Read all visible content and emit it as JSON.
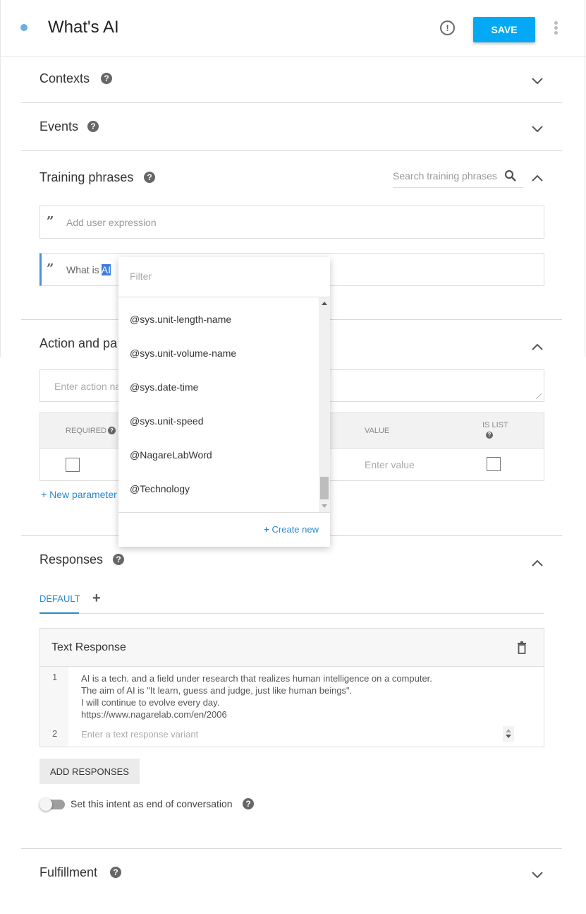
{
  "header": {
    "title": "What's AI",
    "save_label": "SAVE",
    "status_dot_color": "#6aaee3",
    "accent_color": "#03a9f4"
  },
  "sections": {
    "contexts": {
      "title": "Contexts",
      "expanded": false
    },
    "events": {
      "title": "Events",
      "expanded": false
    },
    "training": {
      "title": "Training phrases",
      "expanded": true,
      "search_placeholder": "Search training phrases",
      "add_placeholder": "Add user expression",
      "phrases": [
        {
          "prefix": "What is ",
          "selected": "AI"
        }
      ]
    },
    "action": {
      "title": "Action and parameters",
      "title_visible": "Action and pa",
      "expanded": true,
      "action_placeholder": "Enter action name",
      "action_placeholder_visible": "Enter action na",
      "columns": {
        "required": "REQUIRED",
        "value": "VALUE",
        "is_list": "IS LIST"
      },
      "value_placeholder": "Enter value",
      "required_checked": false,
      "is_list_checked": false,
      "new_parameter": "+ New parameter"
    },
    "responses": {
      "title": "Responses",
      "expanded": true,
      "tabs": [
        {
          "label": "DEFAULT",
          "active": true
        }
      ],
      "add_tab": "+",
      "card_title": "Text Response",
      "lines": [
        {
          "num": "1",
          "text": [
            "AI is a tech. and a field under research that realizes human intelligence on a computer.",
            "The aim of AI is \"It learn, guess and judge, just like human beings\".",
            "I will continue to evolve every day.",
            "https://www.nagarelab.com/en/2006"
          ]
        },
        {
          "num": "2",
          "placeholder": "Enter a text response variant"
        }
      ],
      "add_responses": "ADD RESPONSES",
      "end_conversation_label": "Set this intent as end of conversation",
      "end_conversation_on": false
    },
    "fulfillment": {
      "title": "Fulfillment",
      "expanded": false
    }
  },
  "entity_dropdown": {
    "filter_placeholder": "Filter",
    "items": [
      "@sys.unit-length-name",
      "@sys.unit-volume-name",
      "@sys.date-time",
      "@sys.unit-speed",
      "@NagareLabWord",
      "@Technology"
    ],
    "create_new": "Create new",
    "link_color": "#2a8acb"
  }
}
